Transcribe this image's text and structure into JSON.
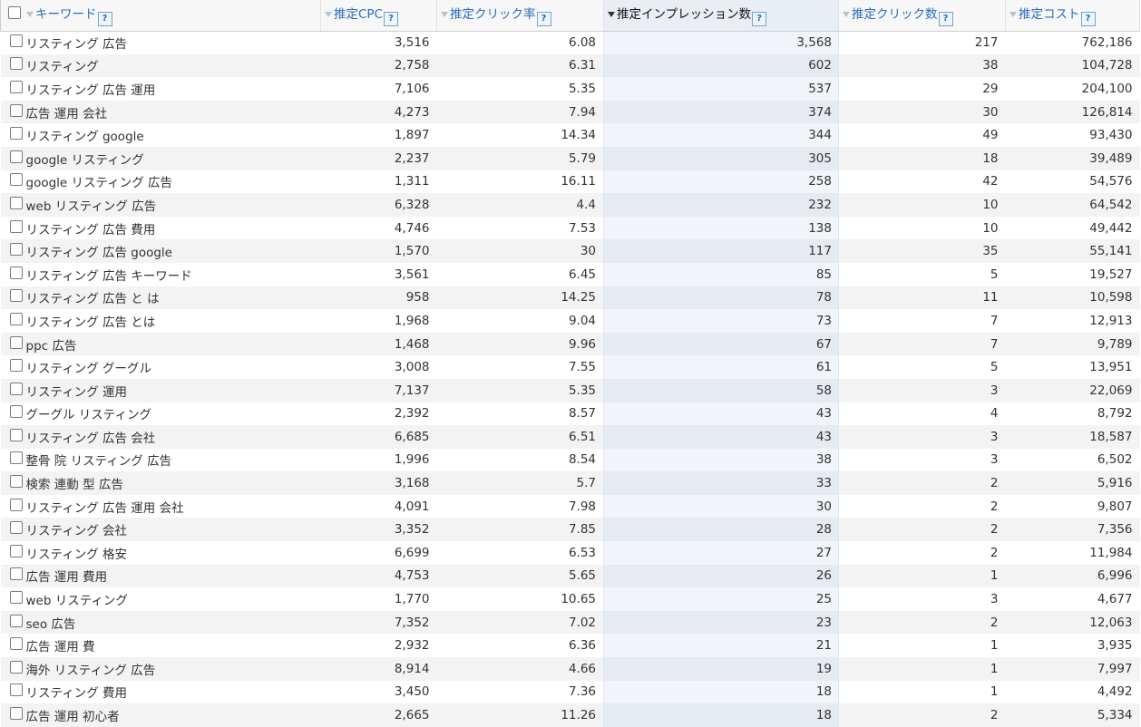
{
  "headers": {
    "keyword": "キーワード",
    "cpc": "推定CPC",
    "ctr": "推定クリック率",
    "impressions": "推定インプレッション数",
    "clicks": "推定クリック数",
    "cost": "推定コスト",
    "help": "?"
  },
  "sorted_column": "impressions",
  "rows": [
    {
      "keyword": "リスティング 広告",
      "cpc": "3,516",
      "ctr": "6.08",
      "impressions": "3,568",
      "clicks": "217",
      "cost": "762,186"
    },
    {
      "keyword": "リスティング",
      "cpc": "2,758",
      "ctr": "6.31",
      "impressions": "602",
      "clicks": "38",
      "cost": "104,728"
    },
    {
      "keyword": "リスティング 広告 運用",
      "cpc": "7,106",
      "ctr": "5.35",
      "impressions": "537",
      "clicks": "29",
      "cost": "204,100"
    },
    {
      "keyword": "広告 運用 会社",
      "cpc": "4,273",
      "ctr": "7.94",
      "impressions": "374",
      "clicks": "30",
      "cost": "126,814"
    },
    {
      "keyword": "リスティング google",
      "cpc": "1,897",
      "ctr": "14.34",
      "impressions": "344",
      "clicks": "49",
      "cost": "93,430"
    },
    {
      "keyword": "google リスティング",
      "cpc": "2,237",
      "ctr": "5.79",
      "impressions": "305",
      "clicks": "18",
      "cost": "39,489"
    },
    {
      "keyword": "google リスティング 広告",
      "cpc": "1,311",
      "ctr": "16.11",
      "impressions": "258",
      "clicks": "42",
      "cost": "54,576"
    },
    {
      "keyword": "web リスティング 広告",
      "cpc": "6,328",
      "ctr": "4.4",
      "impressions": "232",
      "clicks": "10",
      "cost": "64,542"
    },
    {
      "keyword": "リスティング 広告 費用",
      "cpc": "4,746",
      "ctr": "7.53",
      "impressions": "138",
      "clicks": "10",
      "cost": "49,442"
    },
    {
      "keyword": "リスティング 広告 google",
      "cpc": "1,570",
      "ctr": "30",
      "impressions": "117",
      "clicks": "35",
      "cost": "55,141"
    },
    {
      "keyword": "リスティング 広告 キーワード",
      "cpc": "3,561",
      "ctr": "6.45",
      "impressions": "85",
      "clicks": "5",
      "cost": "19,527"
    },
    {
      "keyword": "リスティング 広告 と は",
      "cpc": "958",
      "ctr": "14.25",
      "impressions": "78",
      "clicks": "11",
      "cost": "10,598"
    },
    {
      "keyword": "リスティング 広告 とは",
      "cpc": "1,968",
      "ctr": "9.04",
      "impressions": "73",
      "clicks": "7",
      "cost": "12,913"
    },
    {
      "keyword": "ppc 広告",
      "cpc": "1,468",
      "ctr": "9.96",
      "impressions": "67",
      "clicks": "7",
      "cost": "9,789"
    },
    {
      "keyword": "リスティング グーグル",
      "cpc": "3,008",
      "ctr": "7.55",
      "impressions": "61",
      "clicks": "5",
      "cost": "13,951"
    },
    {
      "keyword": "リスティング 運用",
      "cpc": "7,137",
      "ctr": "5.35",
      "impressions": "58",
      "clicks": "3",
      "cost": "22,069"
    },
    {
      "keyword": "グーグル リスティング",
      "cpc": "2,392",
      "ctr": "8.57",
      "impressions": "43",
      "clicks": "4",
      "cost": "8,792"
    },
    {
      "keyword": "リスティング 広告 会社",
      "cpc": "6,685",
      "ctr": "6.51",
      "impressions": "43",
      "clicks": "3",
      "cost": "18,587"
    },
    {
      "keyword": "整骨 院 リスティング 広告",
      "cpc": "1,996",
      "ctr": "8.54",
      "impressions": "38",
      "clicks": "3",
      "cost": "6,502"
    },
    {
      "keyword": "検索 連動 型 広告",
      "cpc": "3,168",
      "ctr": "5.7",
      "impressions": "33",
      "clicks": "2",
      "cost": "5,916"
    },
    {
      "keyword": "リスティング 広告 運用 会社",
      "cpc": "4,091",
      "ctr": "7.98",
      "impressions": "30",
      "clicks": "2",
      "cost": "9,807"
    },
    {
      "keyword": "リスティング 会社",
      "cpc": "3,352",
      "ctr": "7.85",
      "impressions": "28",
      "clicks": "2",
      "cost": "7,356"
    },
    {
      "keyword": "リスティング 格安",
      "cpc": "6,699",
      "ctr": "6.53",
      "impressions": "27",
      "clicks": "2",
      "cost": "11,984"
    },
    {
      "keyword": "広告 運用 費用",
      "cpc": "4,753",
      "ctr": "5.65",
      "impressions": "26",
      "clicks": "1",
      "cost": "6,996"
    },
    {
      "keyword": "web リスティング",
      "cpc": "1,770",
      "ctr": "10.65",
      "impressions": "25",
      "clicks": "3",
      "cost": "4,677"
    },
    {
      "keyword": "seo 広告",
      "cpc": "7,352",
      "ctr": "7.02",
      "impressions": "23",
      "clicks": "2",
      "cost": "12,063"
    },
    {
      "keyword": "広告 運用 費",
      "cpc": "2,932",
      "ctr": "6.36",
      "impressions": "21",
      "clicks": "1",
      "cost": "3,935"
    },
    {
      "keyword": "海外 リスティング 広告",
      "cpc": "8,914",
      "ctr": "4.66",
      "impressions": "19",
      "clicks": "1",
      "cost": "7,997"
    },
    {
      "keyword": "リスティング 費用",
      "cpc": "3,450",
      "ctr": "7.36",
      "impressions": "18",
      "clicks": "1",
      "cost": "4,492"
    },
    {
      "keyword": "広告 運用 初心者",
      "cpc": "2,665",
      "ctr": "11.26",
      "impressions": "18",
      "clicks": "2",
      "cost": "5,334"
    }
  ]
}
